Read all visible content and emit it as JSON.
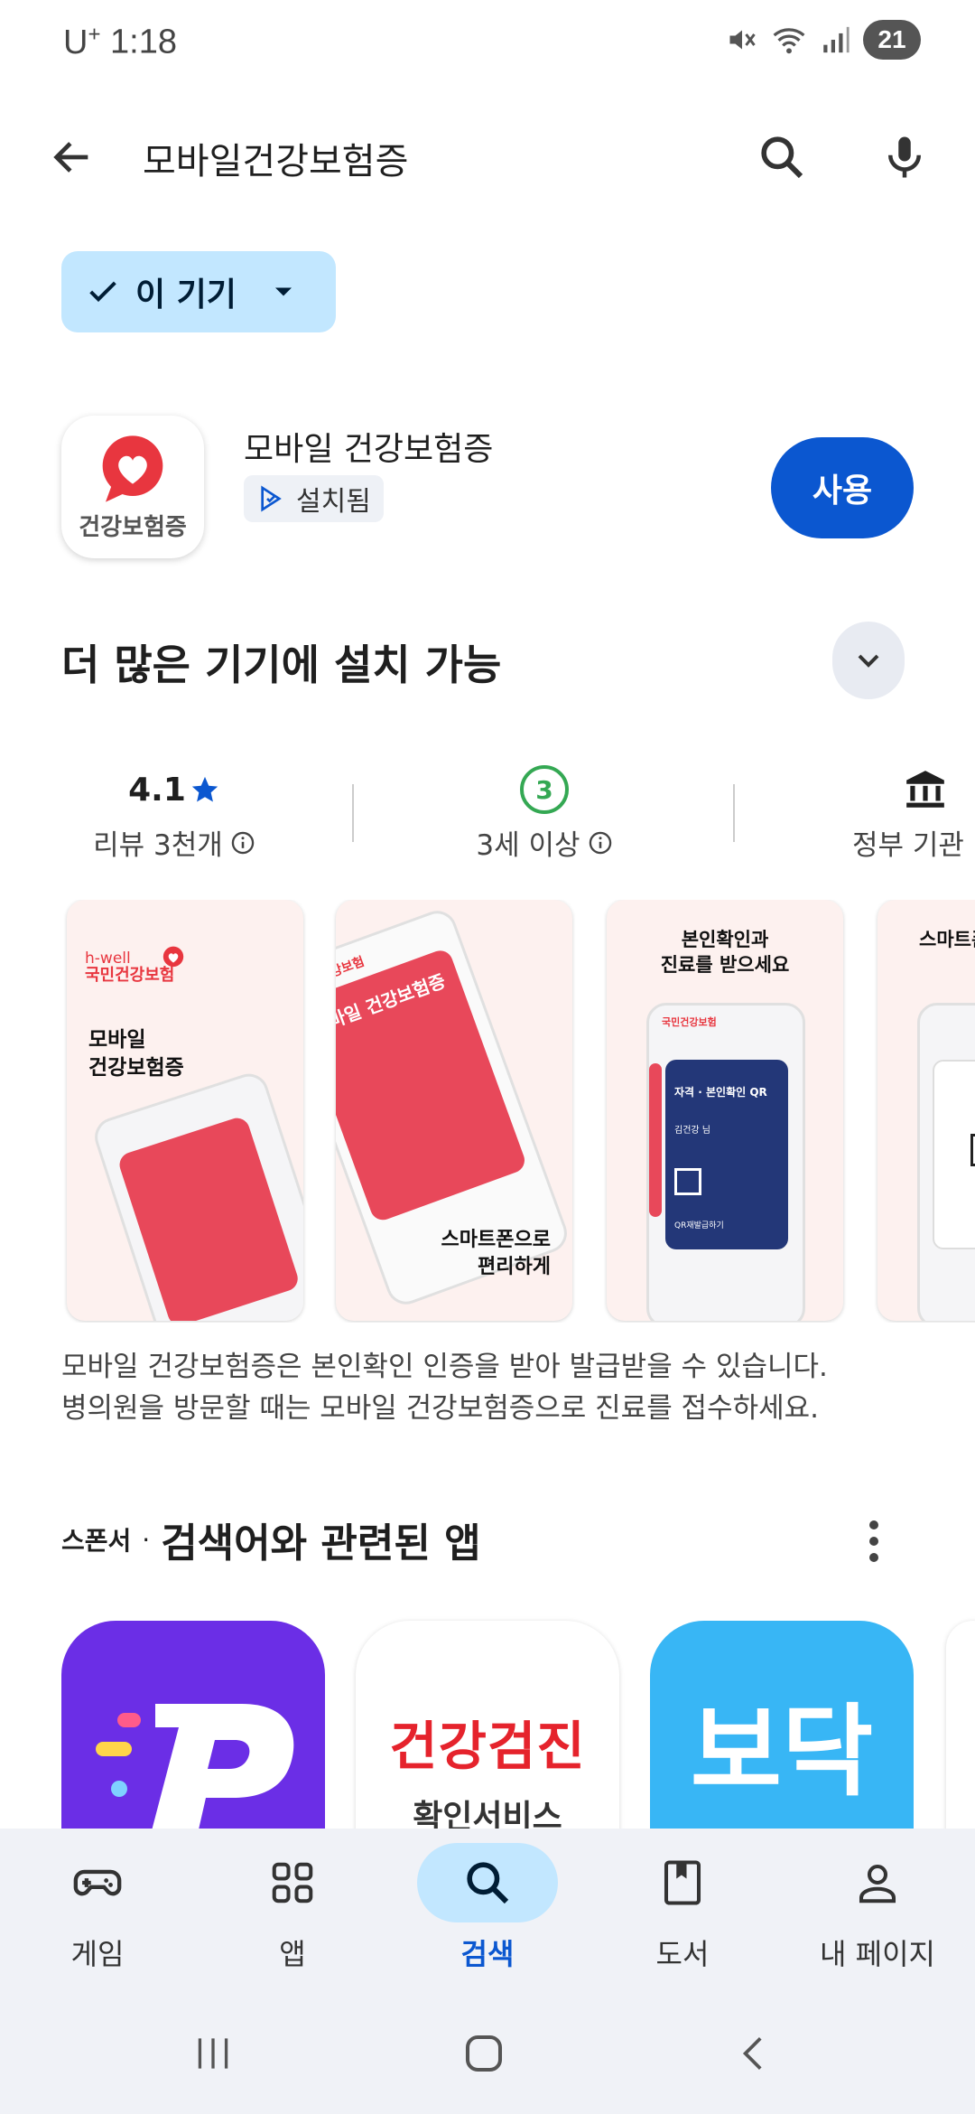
{
  "status_bar": {
    "carrier": "U",
    "carrier_plus": "+",
    "time": "1:18",
    "battery": "21"
  },
  "search": {
    "query": "모바일건강보험증"
  },
  "filter_chip": {
    "label": "이 기기"
  },
  "app": {
    "name": "모바일 건강보험증",
    "icon_text": "건강보험증",
    "installed_label": "설치됨",
    "open_label": "사용",
    "brand_color": "#e8363f"
  },
  "more_devices": {
    "title": "더 많은 기기에 설치 가능"
  },
  "stats": {
    "rating": "4.1",
    "reviews": "리뷰 3천개",
    "age_badge": "3",
    "age_label": "3세 이상",
    "category": "정부 기관"
  },
  "screenshots": [
    {
      "brand": "국민건강보험",
      "tagline": "h-well",
      "title": "모바일\n건강보험증",
      "card": "모바일 건강보험증"
    },
    {
      "brand": "국민건강보험",
      "card": "모바일 건강보험증",
      "caption": "스마트폰으로\n편리하게"
    },
    {
      "header": "본인확인과\n진료를 받으세요",
      "brand": "국민건강보험",
      "card_title": "자격 · 본인확인 QR",
      "card_name": "김건강 님",
      "card_btn": "QR재발급하기"
    },
    {
      "header": "스마트폰"
    }
  ],
  "description": {
    "line1": "모바일 건강보험증은 본인확인 인증을 받아 발급받을 수 있습니다.",
    "line2": "병의원을 방문할 때는 모바일 건강보험증으로 진료를 접수하세요."
  },
  "sponsored": {
    "tag": "스폰서",
    "dot": "·",
    "title": "검색어와 관련된 앱",
    "apps": [
      {
        "name_text": "P",
        "color": "#6b2ee6"
      },
      {
        "title": "건강검진",
        "subtitle": "확인서비스",
        "color": "#e5232c"
      },
      {
        "name_text": "보닥",
        "color": "#38b6f5"
      }
    ]
  },
  "bottom_nav": {
    "games": "게임",
    "apps": "앱",
    "search": "검색",
    "books": "도서",
    "mypage": "내 페이지"
  }
}
